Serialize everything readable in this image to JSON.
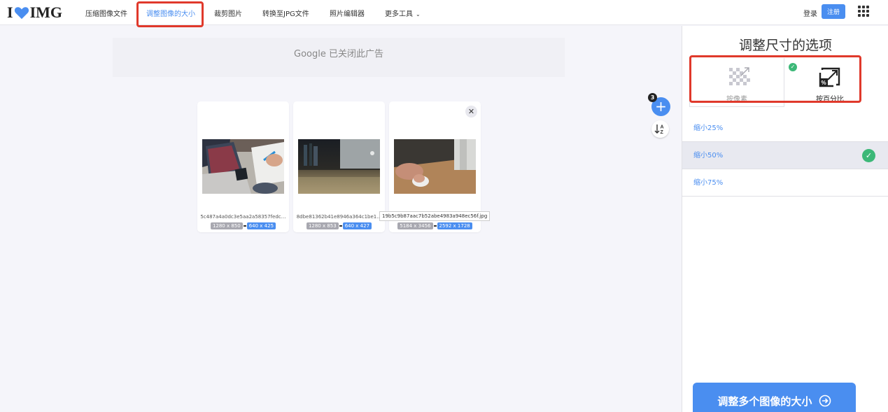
{
  "header": {
    "logo": {
      "left": "I",
      "right": "IMG"
    },
    "nav": [
      {
        "label": "压缩图像文件",
        "active": false
      },
      {
        "label": "调整图像的大小",
        "active": true
      },
      {
        "label": "裁剪图片",
        "active": false
      },
      {
        "label": "转换至JPG文件",
        "active": false
      },
      {
        "label": "照片编辑器",
        "active": false
      },
      {
        "label": "更多工具",
        "active": false,
        "icon": "chevron-down-icon"
      }
    ],
    "login": "登录",
    "signup": "注册",
    "apps_icon": "grid-menu-icon"
  },
  "ad": {
    "text": "Google 已关闭此广告"
  },
  "files": {
    "count": "3",
    "items": [
      {
        "name": "5c487a4a0dc3e5aa2a58357fedc…",
        "original": "1280 x 850",
        "resized": "640 x 425"
      },
      {
        "name": "8dbe81362b41e8946a364c1be1…",
        "original": "1280 x 853",
        "resized": "640 x 427"
      },
      {
        "name": "19b5c9b87aac7b52abe4983a948ec56f.jpg",
        "original": "5184 x 3456",
        "resized": "2592 x 1728"
      }
    ],
    "tooltip": "19b5c9b87aac7b52abe4983a948ec56f.jpg"
  },
  "panel": {
    "title": "调整尺寸的选项",
    "options": {
      "by_pixels": "按像素",
      "by_percent": "按百分比",
      "selected": "by_percent"
    },
    "percent_options": [
      {
        "label": "缩小25%",
        "selected": false
      },
      {
        "label": "缩小50%",
        "selected": true
      },
      {
        "label": "缩小75%",
        "selected": false
      }
    ],
    "action": "调整多个图像的大小"
  },
  "colors": {
    "accent": "#4a8ef0",
    "success": "#3cb878",
    "highlight": "#e0392b"
  }
}
